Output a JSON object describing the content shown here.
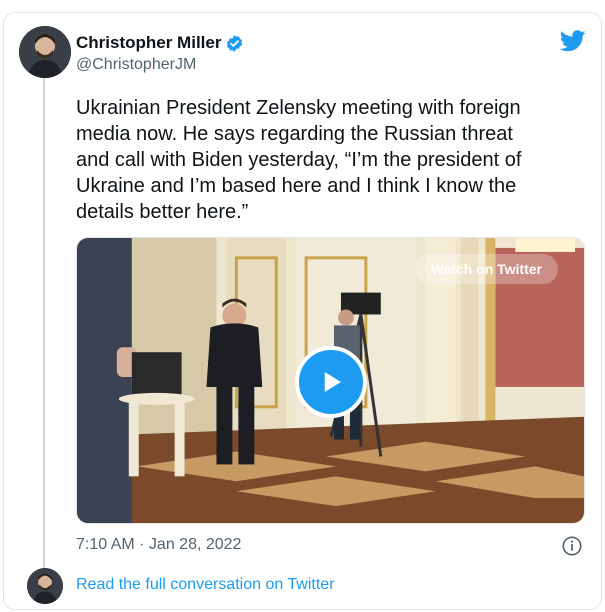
{
  "author": {
    "name": "Christopher Miller",
    "handle": "@ChristopherJM",
    "verified_icon": "verified-badge-icon",
    "brand_icon": "twitter-bird-icon"
  },
  "tweet": {
    "text": "Ukrainian President Zelensky meeting with foreign\nmedia now. He says regarding the Russian threat\nand call with Biden yesterday, “I’m the president of\nUkraine and I’m based here and I think I know the\ndetails better here.”",
    "timestamp": "7:10 AM · Jan 28, 2022"
  },
  "media": {
    "watch_label": "Watch on Twitter",
    "play_icon": "play-icon"
  },
  "footer": {
    "read_more": "Read the full conversation on Twitter",
    "info_icon": "info-icon"
  },
  "colors": {
    "accent": "#1d9bf0",
    "text": "#0f1419",
    "muted": "#536471"
  }
}
